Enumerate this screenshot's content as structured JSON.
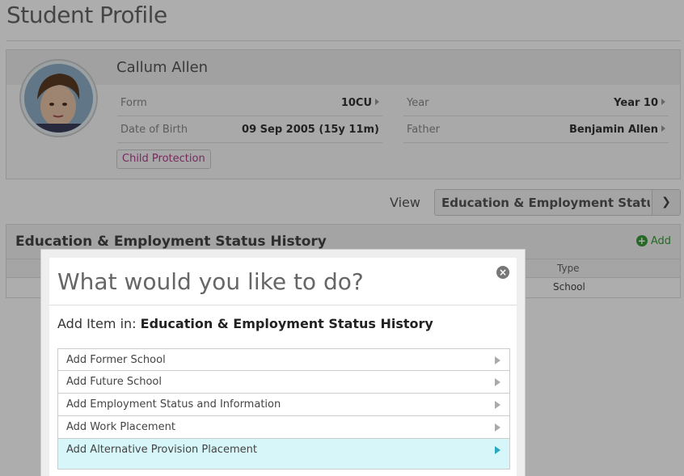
{
  "page": {
    "title": "Student Profile"
  },
  "student": {
    "name": "Callum Allen",
    "form_label": "Form",
    "form_value": "10CU",
    "year_label": "Year",
    "year_value": "Year 10",
    "dob_label": "Date of Birth",
    "dob_value": "09 Sep 2005 (15y 11m)",
    "father_label": "Father",
    "father_value": "Benjamin Allen",
    "badge": "Child Protection"
  },
  "view": {
    "label": "View",
    "selected": "Education & Employment Status History"
  },
  "history": {
    "title": "Education & Employment Status History",
    "add_label": "Add",
    "columns": [
      "Type"
    ],
    "rows": [
      {
        "type": "School"
      }
    ]
  },
  "modal": {
    "title": "What would you like to do?",
    "add_item_prefix": "Add Item in:",
    "add_item_target": "Education & Employment Status History",
    "options": [
      "Add Former School",
      "Add Future School",
      "Add Employment Status and Information",
      "Add Work Placement",
      "Add Alternative Provision Placement"
    ]
  },
  "colors": {
    "overlay": "#000000",
    "badge_text": "#b03d8c",
    "add_green": "#3a9a3a",
    "highlight": "#d6f6f9"
  },
  "icons": [
    "chevron-right-icon",
    "chevron-down-icon",
    "plus-circle-icon",
    "close-circle-icon"
  ]
}
